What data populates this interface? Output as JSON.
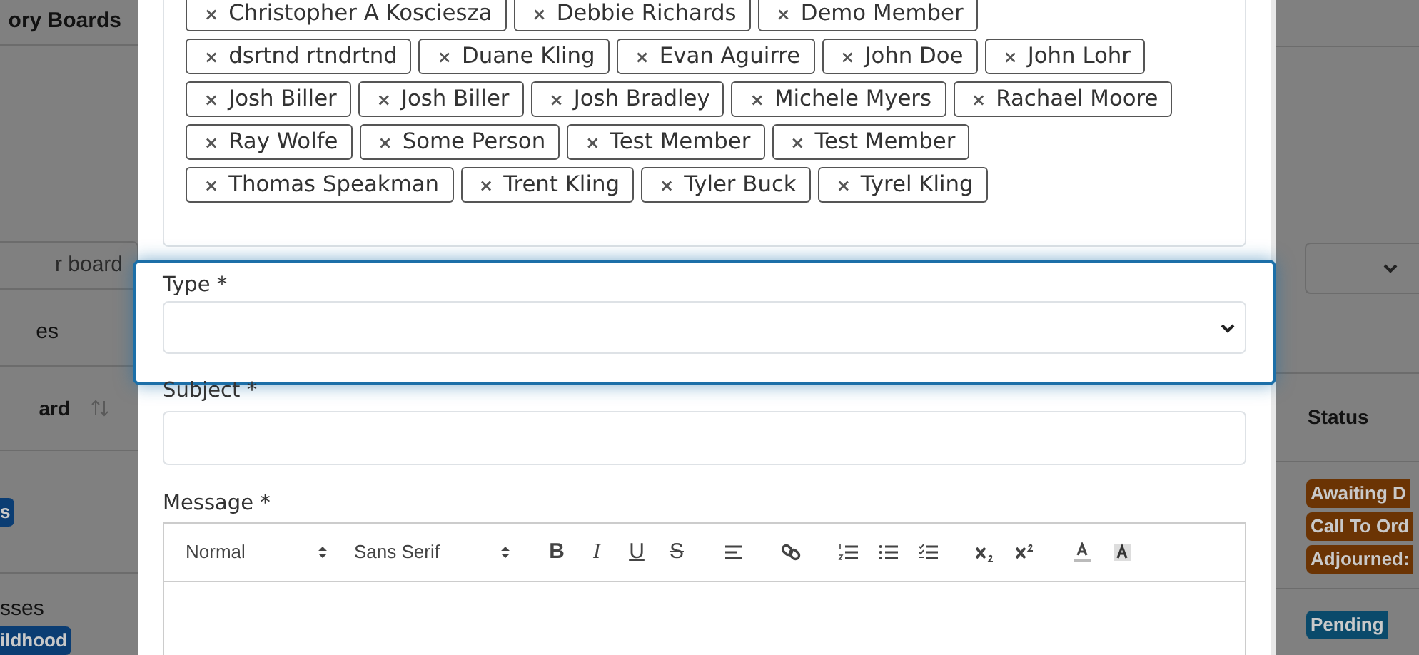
{
  "background": {
    "heading": "ory Boards",
    "board_select": {
      "value": "r board"
    },
    "filter_label": "es",
    "table": {
      "columns": [
        {
          "label": "ard",
          "sortable": true
        },
        {
          "label": "Status"
        }
      ],
      "rows": [
        {
          "column_1": {
            "badges": [
              {
                "text": "s",
                "color": "#0b3d73"
              }
            ]
          },
          "status": [
            {
              "text": "Awaiting D",
              "color": "#6b3404"
            },
            {
              "text": "Call To Ord",
              "color": "#6b3404"
            },
            {
              "text": "Adjourned:",
              "color": "#6b3404"
            }
          ]
        },
        {
          "column_1": {
            "text": "sses",
            "badges": [
              {
                "text": "ildhood",
                "color": "#0b3d73"
              }
            ]
          },
          "status": [
            {
              "text": "Pending",
              "color": "#0a4a6b"
            }
          ]
        }
      ]
    }
  },
  "modal": {
    "recipient_rows": [
      [
        {
          "remove": "×",
          "name": "Christopher A Kosciesza"
        },
        {
          "remove": "×",
          "name": "Debbie Richards"
        },
        {
          "remove": "×",
          "name": "Demo Member"
        }
      ],
      [
        {
          "remove": "×",
          "name": "dsrtnd rtndrtnd"
        },
        {
          "remove": "×",
          "name": "Duane Kling"
        },
        {
          "remove": "×",
          "name": "Evan Aguirre"
        },
        {
          "remove": "×",
          "name": "John Doe"
        },
        {
          "remove": "×",
          "name": "John Lohr"
        }
      ],
      [
        {
          "remove": "×",
          "name": "Josh Biller"
        },
        {
          "remove": "×",
          "name": "Josh Biller"
        },
        {
          "remove": "×",
          "name": "Josh Bradley"
        },
        {
          "remove": "×",
          "name": "Michele Myers"
        },
        {
          "remove": "×",
          "name": "Rachael Moore"
        }
      ],
      [
        {
          "remove": "×",
          "name": "Ray Wolfe"
        },
        {
          "remove": "×",
          "name": "Some Person"
        },
        {
          "remove": "×",
          "name": "Test Member"
        },
        {
          "remove": "×",
          "name": "Test Member"
        }
      ],
      [
        {
          "remove": "×",
          "name": "Thomas Speakman"
        },
        {
          "remove": "×",
          "name": "Trent Kling"
        },
        {
          "remove": "×",
          "name": "Tyler Buck"
        },
        {
          "remove": "×",
          "name": "Tyrel Kling"
        }
      ]
    ],
    "type": {
      "label": "Type *",
      "focused": true
    },
    "subject": {
      "label": "Subject *"
    },
    "message": {
      "label": "Message *",
      "toolbar": [
        {
          "kind": "select",
          "text": "Normal"
        },
        {
          "kind": "select",
          "text": "Sans Serif"
        },
        {
          "kind": "letter",
          "text": "B"
        },
        {
          "kind": "letter",
          "text": "I"
        },
        {
          "kind": "letter",
          "text": "U"
        },
        {
          "kind": "letter",
          "text": "S"
        },
        {
          "kind": "icon"
        },
        {
          "kind": "icon"
        },
        {
          "kind": "icon"
        },
        {
          "kind": "icon"
        },
        {
          "kind": "icon"
        },
        {
          "kind": "icon"
        },
        {
          "kind": "icon"
        },
        {
          "kind": "icon"
        },
        {
          "kind": "icon"
        }
      ]
    }
  }
}
